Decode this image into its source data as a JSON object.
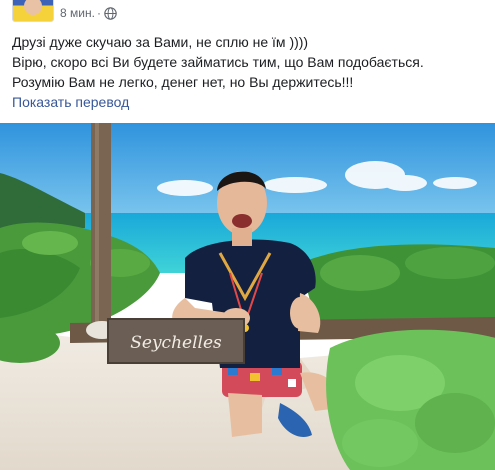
{
  "post": {
    "timestamp": "8 мин.",
    "separator": "·",
    "privacy_icon": "globe-icon",
    "lines": [
      "Друзі дуже скучаю за Вами, не сплю не їм ))))",
      "Вірю, скоро всі Ви будете займатись тим, що Вам подобається.",
      "Розумію Вам не легко, денег нет, но Вы держитесь!!!"
    ],
    "translate_label": "Показать перевод"
  },
  "photo": {
    "sign_text": "Seychelles"
  },
  "colors": {
    "link": "#385898",
    "meta": "#616770",
    "sea": "#1bb3d6",
    "sky": "#2f93dd"
  }
}
